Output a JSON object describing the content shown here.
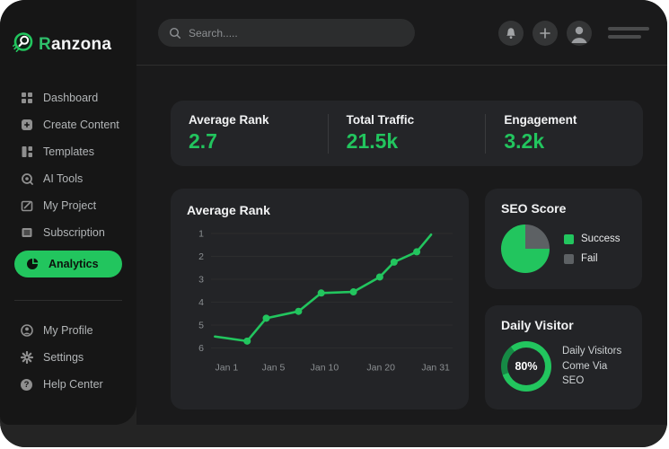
{
  "brand": {
    "name_first_letter": "R",
    "name_rest": "anzona"
  },
  "topbar": {
    "search_placeholder": "Search....."
  },
  "sidebar": {
    "items": [
      {
        "label": "Dashboard"
      },
      {
        "label": "Create Content"
      },
      {
        "label": "Templates"
      },
      {
        "label": "AI Tools"
      },
      {
        "label": "My Project"
      },
      {
        "label": "Subscription"
      },
      {
        "label": "Analytics",
        "active": true
      }
    ],
    "footer_items": [
      {
        "label": "My Profile"
      },
      {
        "label": "Settings"
      },
      {
        "label": "Help Center"
      }
    ]
  },
  "stats": [
    {
      "label": "Average Rank",
      "value": "2.7"
    },
    {
      "label": "Total Traffic",
      "value": "21.5k"
    },
    {
      "label": "Engagement",
      "value": "3.2k"
    }
  ],
  "chart_data": {
    "type": "line",
    "title": "Average Rank",
    "x_tick_labels": [
      "Jan 1",
      "Jan 5",
      "Jan 10",
      "Jan 20",
      "Jan 31"
    ],
    "x_tick_pos": [
      0.054,
      0.25,
      0.464,
      0.7,
      0.929
    ],
    "y_ticks": [
      1,
      2,
      3,
      4,
      5,
      6
    ],
    "ylim": [
      1,
      6
    ],
    "y_axis_inverted": true,
    "grid": true,
    "series": [
      {
        "name": "Average Rank",
        "color": "#22c55e",
        "points": [
          {
            "x": 0.005,
            "y": 5.5,
            "dot": false
          },
          {
            "x": 0.14,
            "y": 5.7,
            "dot": true
          },
          {
            "x": 0.22,
            "y": 4.7,
            "dot": true
          },
          {
            "x": 0.355,
            "y": 4.4,
            "dot": true
          },
          {
            "x": 0.45,
            "y": 3.6,
            "dot": true
          },
          {
            "x": 0.585,
            "y": 3.55,
            "dot": true
          },
          {
            "x": 0.695,
            "y": 2.9,
            "dot": true
          },
          {
            "x": 0.755,
            "y": 2.25,
            "dot": true
          },
          {
            "x": 0.85,
            "y": 1.8,
            "dot": true
          },
          {
            "x": 0.91,
            "y": 1.05,
            "dot": false
          }
        ]
      }
    ]
  },
  "seo": {
    "title": "SEO Score",
    "success_pct": 75,
    "fail_pct": 25,
    "legend": [
      {
        "label": "Success",
        "color": "#22c55e"
      },
      {
        "label": "Fail",
        "color": "#5d6164"
      }
    ]
  },
  "visitor": {
    "title": "Daily Visitor",
    "percent": "80%",
    "percent_value": 80,
    "caption": "Daily Visitors Come Via SEO"
  },
  "colors": {
    "accent_green": "#22c55e",
    "accent_green_dark": "#168a45",
    "fail_gray": "#5d6164",
    "card_bg": "#232427",
    "sidebar_bg": "#161616",
    "main_bg": "#1a1a1b"
  }
}
